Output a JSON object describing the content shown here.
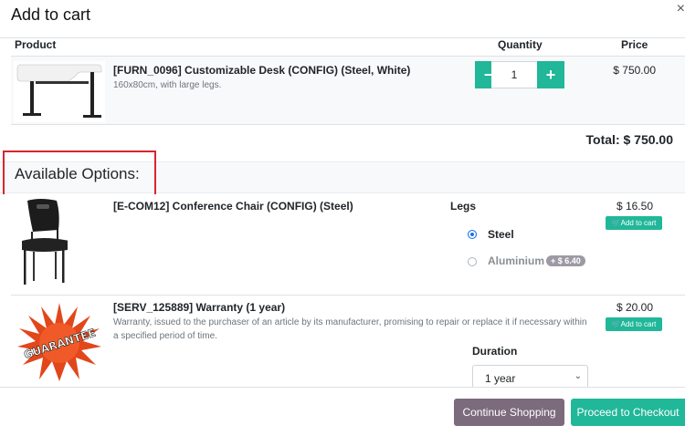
{
  "modal": {
    "title": "Add to cart",
    "close": "×"
  },
  "table_headers": {
    "product": "Product",
    "quantity": "Quantity",
    "price": "Price"
  },
  "main_product": {
    "name": "[FURN_0096] Customizable Desk (CONFIG) (Steel, White)",
    "description": "160x80cm, with large legs.",
    "quantity": "1",
    "minus": "−",
    "plus": "+",
    "price": "$ 750.00"
  },
  "total": "Total: $ 750.00",
  "options_title": "Available Options:",
  "options": [
    {
      "name": "[E-COM12] Conference Chair (CONFIG) (Steel)",
      "price": "$ 16.50",
      "add_label": "Add to cart",
      "attribute": {
        "label": "Legs",
        "values": [
          {
            "label": "Steel",
            "selected": true
          },
          {
            "label": "Aluminium",
            "selected": false,
            "extra": "+ $ 6.40"
          }
        ]
      }
    },
    {
      "name": "[SERV_125889] Warranty (1 year)",
      "description": "Warranty, issued to the purchaser of an article by its manufacturer, promising to repair or replace it if necessary within a specified period of time.",
      "price": "$ 20.00",
      "add_label": "Add to cart",
      "attribute": {
        "label": "Duration",
        "selected": "1 year"
      }
    }
  ],
  "buttons": {
    "continue": "Continue Shopping",
    "checkout": "Proceed to Checkout"
  },
  "colors": {
    "accent": "#21b799",
    "secondary": "#7c6a7d",
    "highlight_box": "#d9262c"
  },
  "images": {
    "warranty_badge_text": "GUARANTEE"
  }
}
